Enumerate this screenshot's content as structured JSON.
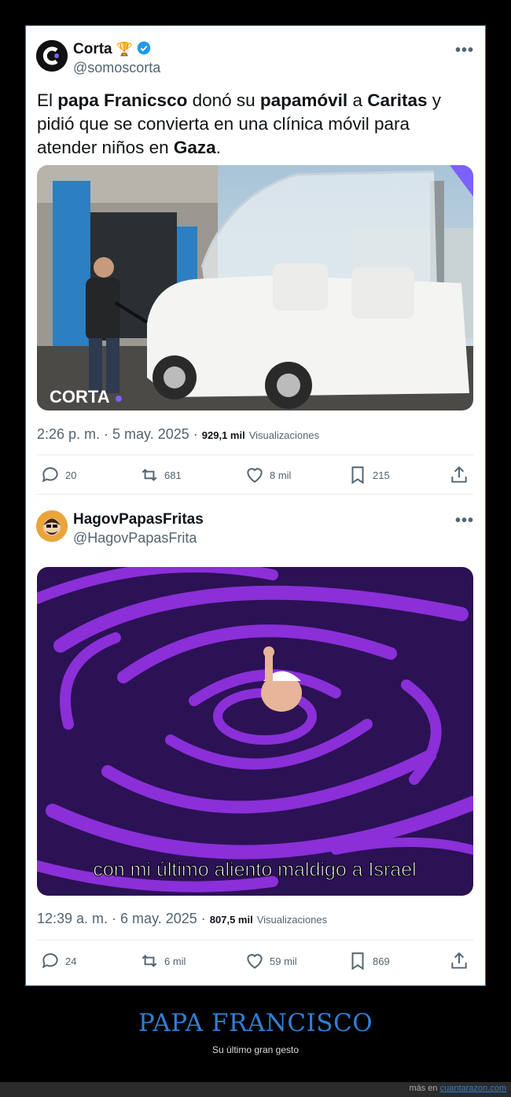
{
  "tweet1": {
    "display_name": "Corta",
    "handle": "@somoscorta",
    "text_parts": [
      "El ",
      "papa Franicsco",
      " donó su ",
      "papamóvil",
      " a ",
      "Caritas",
      " y pidió que se convierta en una clínica móvil para atender niños en ",
      "Gaza",
      "."
    ],
    "image_watermark": "CORTA",
    "time": "2:26 p. m. · 5 may. 2025 · ",
    "views": "929,1 mil",
    "views_label": "Visualizaciones",
    "replies": "20",
    "retweets": "681",
    "likes": "8 mil",
    "bookmarks": "215"
  },
  "tweet2": {
    "display_name": "HagovPapasFritas",
    "handle": "@HagovPapasFrita",
    "image_caption": "con mi último aliento maldigo a Israel",
    "time": "12:39 a. m. · 6 may. 2025 · ",
    "views": "807,5 mil",
    "views_label": "Visualizaciones",
    "replies": "24",
    "retweets": "6 mil",
    "likes": "59 mil",
    "bookmarks": "869"
  },
  "footer": {
    "title": "PAPA FRANCISCO",
    "subtitle": "Su último gran gesto",
    "more_prefix": "más en ",
    "more_link": "cuantarazon.com"
  },
  "colors": {
    "verified": "#1d9bf0",
    "footer_title": "#2f7fd6",
    "swirl_bg": "#2b1254",
    "swirl_stroke": "#8b2fd9"
  }
}
